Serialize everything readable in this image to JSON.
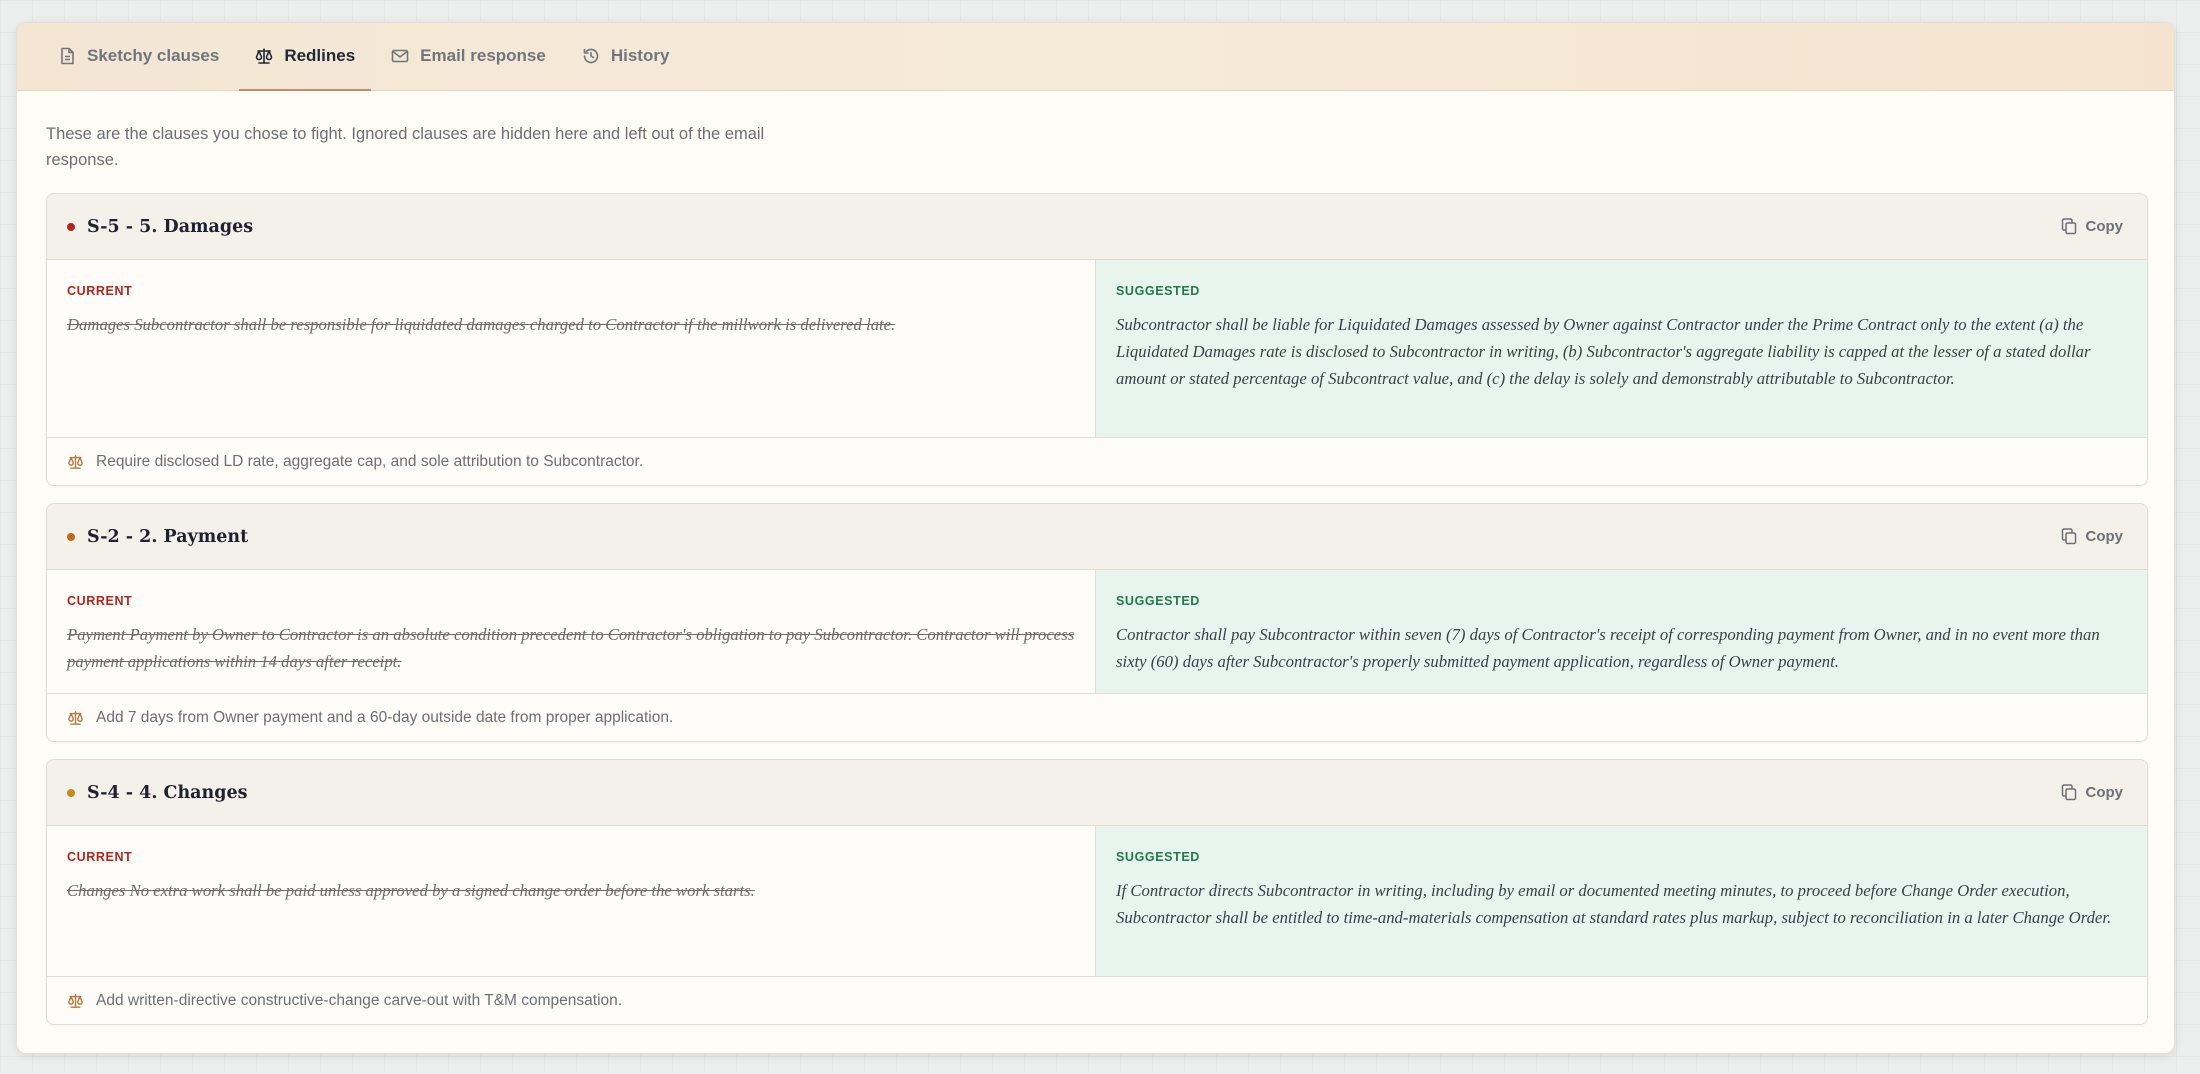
{
  "tabs": [
    {
      "label": "Sketchy clauses",
      "icon": "document-icon",
      "active": false
    },
    {
      "label": "Redlines",
      "icon": "scale-icon",
      "active": true
    },
    {
      "label": "Email response",
      "icon": "mail-icon",
      "active": false
    },
    {
      "label": "History",
      "icon": "history-icon",
      "active": false
    }
  ],
  "intro": "These are the clauses you chose to fight. Ignored clauses are hidden here and left out of the email response.",
  "labels": {
    "current": "CURRENT",
    "suggested": "SUGGESTED",
    "copy": "Copy"
  },
  "colors": {
    "severity_high": "#b3261e",
    "severity_medium": "#c2691e",
    "severity_low": "#c98a1a",
    "active_tab_underline": "#d08a63",
    "suggested_bg": "#e8f4ee"
  },
  "redlines": [
    {
      "title": "S-5 - 5. Damages",
      "severity": "high",
      "current": "Damages Subcontractor shall be responsible for liquidated damages charged to Contractor if the millwork is delivered late.",
      "suggested": "Subcontractor shall be liable for Liquidated Damages assessed by Owner against Contractor under the Prime Contract only to the extent (a) the Liquidated Damages rate is disclosed to Subcontractor in writing, (b) Subcontractor's aggregate liability is capped at the lesser of a stated dollar amount or stated percentage of Subcontract value, and (c) the delay is solely and demonstrably attributable to Subcontractor.",
      "note": "Require disclosed LD rate, aggregate cap, and sole attribution to Subcontractor."
    },
    {
      "title": "S-2 - 2. Payment",
      "severity": "medium",
      "current": "Payment Payment by Owner to Contractor is an absolute condition precedent to Contractor's obligation to pay Subcontractor. Contractor will process payment applications within 14 days after receipt.",
      "suggested": "Contractor shall pay Subcontractor within seven (7) days of Contractor's receipt of corresponding payment from Owner, and in no event more than sixty (60) days after Subcontractor's properly submitted payment application, regardless of Owner payment.",
      "note": "Add 7 days from Owner payment and a 60-day outside date from proper application."
    },
    {
      "title": "S-4 - 4. Changes",
      "severity": "low",
      "current": "Changes No extra work shall be paid unless approved by a signed change order before the work starts.",
      "suggested": "If Contractor directs Subcontractor in writing, including by email or documented meeting minutes, to proceed before Change Order execution, Subcontractor shall be entitled to time-and-materials compensation at standard rates plus markup, subject to reconciliation in a later Change Order.",
      "note": "Add written-directive constructive-change carve-out with T&M compensation."
    }
  ]
}
